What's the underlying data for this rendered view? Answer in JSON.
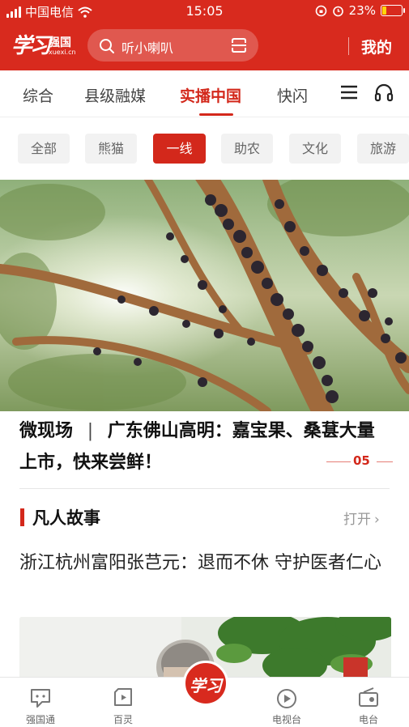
{
  "status_bar": {
    "carrier": "中国电信",
    "time": "15:05",
    "battery_percent": "23%",
    "battery_level": 0.23,
    "icons": [
      "signal-icon",
      "wifi-icon",
      "screen-lock-icon",
      "alarm-icon",
      "battery-charging-icon"
    ]
  },
  "header": {
    "logo_glyph": "学习",
    "logo_name": "强国",
    "logo_domain": "xuexi.cn",
    "search_placeholder": "听小喇叭",
    "mine_label": "我的",
    "background_color": "#d82a1e"
  },
  "tabs": [
    {
      "label": "综合",
      "active": false
    },
    {
      "label": "县级融媒",
      "active": false
    },
    {
      "label": "实播中国",
      "active": true
    },
    {
      "label": "快闪",
      "active": false
    }
  ],
  "categories": [
    {
      "label": "全部",
      "active": false
    },
    {
      "label": "熊猫",
      "active": false
    },
    {
      "label": "一线",
      "active": true
    },
    {
      "label": "助农",
      "active": false
    },
    {
      "label": "文化",
      "active": false
    },
    {
      "label": "旅游",
      "active": false
    }
  ],
  "hero": {
    "title_prefix": "微现场",
    "separator": "|",
    "title_main": "广东佛山高明：嘉宝果、桑葚大量上市，快来尝鲜！",
    "page_number": "05"
  },
  "section": {
    "title": "凡人故事",
    "open_label": "打开",
    "story_title": "浙江杭州富阳张芑元：退而不休 守护医者仁心"
  },
  "bottom_nav": [
    {
      "label": "强国通",
      "icon": "chat-icon"
    },
    {
      "label": "百灵",
      "icon": "short-video-icon"
    },
    {
      "label": "学习",
      "icon": "home-logo-icon"
    },
    {
      "label": "电视台",
      "icon": "play-circle-icon"
    },
    {
      "label": "电台",
      "icon": "radio-icon"
    }
  ],
  "colors": {
    "accent": "#d3281b",
    "inactive_text": "#444444"
  }
}
